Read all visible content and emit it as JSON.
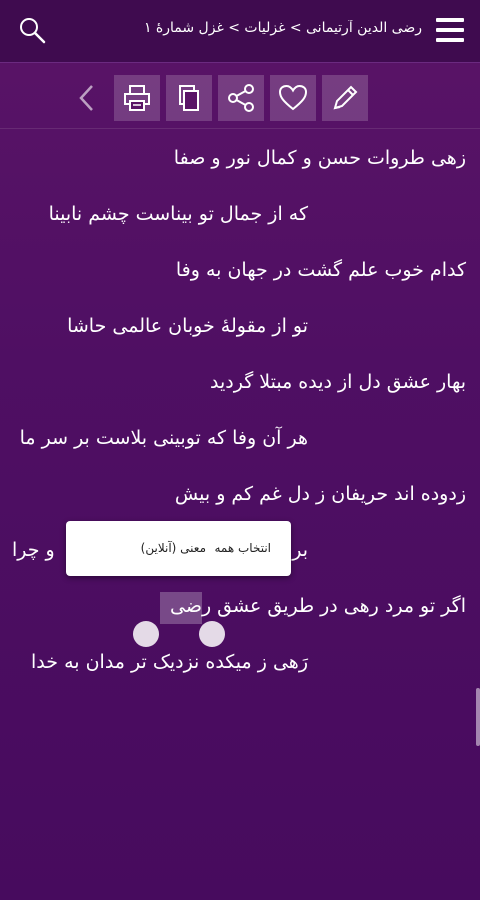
{
  "header": {
    "breadcrumb": "رضی الدین آرتیمانی > غزلیات > غزل شمارهٔ ۱",
    "menu_icon": "hamburger-menu-icon",
    "search_icon": "search-icon"
  },
  "toolbar": {
    "icons": [
      "back-chevron-icon",
      "print-icon",
      "copy-icon",
      "share-icon",
      "heart-icon",
      "edit-pencil-icon"
    ]
  },
  "poem": {
    "lines": [
      "زهی طروات حسن و کمال نور و صفا",
      "که از جمال تو بیناست چشم نابینا",
      "کدام خوب علم گشت در جهان به وفا",
      "تو از مقولهٔ خوبان عالمی حاشا",
      "بهار عشق دل از دیده مبتلا گردید",
      "هر آن وفا که توبینی بلاست بر سر ما",
      "زدوده اند حریفان ز دل غم کم و بیش",
      "بر",
      "اگر تو مرد رهی در طریق عشق رضی",
      "رَهی ز میکده نزدیک تر مدان به خدا"
    ],
    "line8_end": "و چرا"
  },
  "context_menu": {
    "select_all": "انتخاب همه",
    "meaning_online": "معنی (آنلاین)"
  },
  "colors": {
    "background": "#4f0f63",
    "header": "#3f0b4f",
    "text": "#ffffff"
  }
}
